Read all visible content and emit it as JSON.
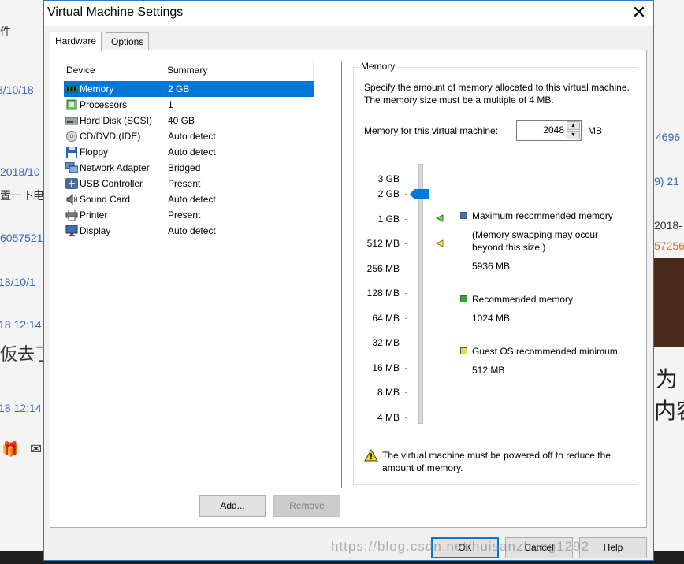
{
  "background": {
    "fragments_left": [
      "件",
      "8/10/18",
      "2018/10",
      "置一下电",
      "6057521",
      "18/10/1",
      "18 12:14",
      "仮去了",
      "18 12:14"
    ],
    "fragments_right": [
      "4696",
      "9) 21",
      "2018-",
      "57256",
      "为",
      "内容"
    ],
    "watermark": "https://blog.csdn.net/huisanzhang1292"
  },
  "window": {
    "title": "Virtual Machine Settings",
    "close_glyph": "✕"
  },
  "tabs": [
    {
      "label": "Hardware",
      "active": true
    },
    {
      "label": "Options",
      "active": false
    }
  ],
  "device_table": {
    "headers": {
      "device": "Device",
      "summary": "Summary"
    },
    "rows": [
      {
        "icon": "memory-icon",
        "device": "Memory",
        "summary": "2 GB",
        "selected": true
      },
      {
        "icon": "processor-icon",
        "device": "Processors",
        "summary": "1"
      },
      {
        "icon": "hard-disk-icon",
        "device": "Hard Disk (SCSI)",
        "summary": "40 GB"
      },
      {
        "icon": "cd-dvd-icon",
        "device": "CD/DVD (IDE)",
        "summary": "Auto detect"
      },
      {
        "icon": "floppy-icon",
        "device": "Floppy",
        "summary": "Auto detect"
      },
      {
        "icon": "network-adapter-icon",
        "device": "Network Adapter",
        "summary": "Bridged"
      },
      {
        "icon": "usb-icon",
        "device": "USB Controller",
        "summary": "Present"
      },
      {
        "icon": "sound-card-icon",
        "device": "Sound Card",
        "summary": "Auto detect"
      },
      {
        "icon": "printer-icon",
        "device": "Printer",
        "summary": "Present"
      },
      {
        "icon": "display-icon",
        "device": "Display",
        "summary": "Auto detect"
      }
    ]
  },
  "list_buttons": {
    "add": "Add...",
    "remove": "Remove"
  },
  "memory": {
    "group_title": "Memory",
    "description": "Specify the amount of memory allocated to this virtual machine. The memory size must be a multiple of 4 MB.",
    "field_label": "Memory for this virtual machine:",
    "value": "2048",
    "unit": "MB",
    "scale_labels": [
      "3 GB",
      "2 GB",
      "1 GB",
      "512 MB",
      "256 MB",
      "128 MB",
      "64 MB",
      "32 MB",
      "16 MB",
      "8 MB",
      "4 MB"
    ],
    "current_value_mb": 2048,
    "legend": [
      {
        "color": "#3f6fc4",
        "title": "Maximum recommended memory",
        "note": "(Memory swapping may occur beyond this size.)",
        "value": "5936 MB"
      },
      {
        "color": "#2faa2f",
        "title": "Recommended memory",
        "note": "",
        "value": "1024 MB"
      },
      {
        "color": "#e6d84a",
        "title": "Guest OS recommended minimum",
        "note": "",
        "value": "512 MB"
      }
    ],
    "warning": "The virtual machine must be powered off to reduce the amount of memory."
  },
  "footer": {
    "ok": "OK",
    "cancel": "Cancel",
    "help": "Help"
  },
  "colors": {
    "accent": "#0078d7",
    "selection": "#0078d7",
    "dialog_border": "#2b79c8"
  }
}
